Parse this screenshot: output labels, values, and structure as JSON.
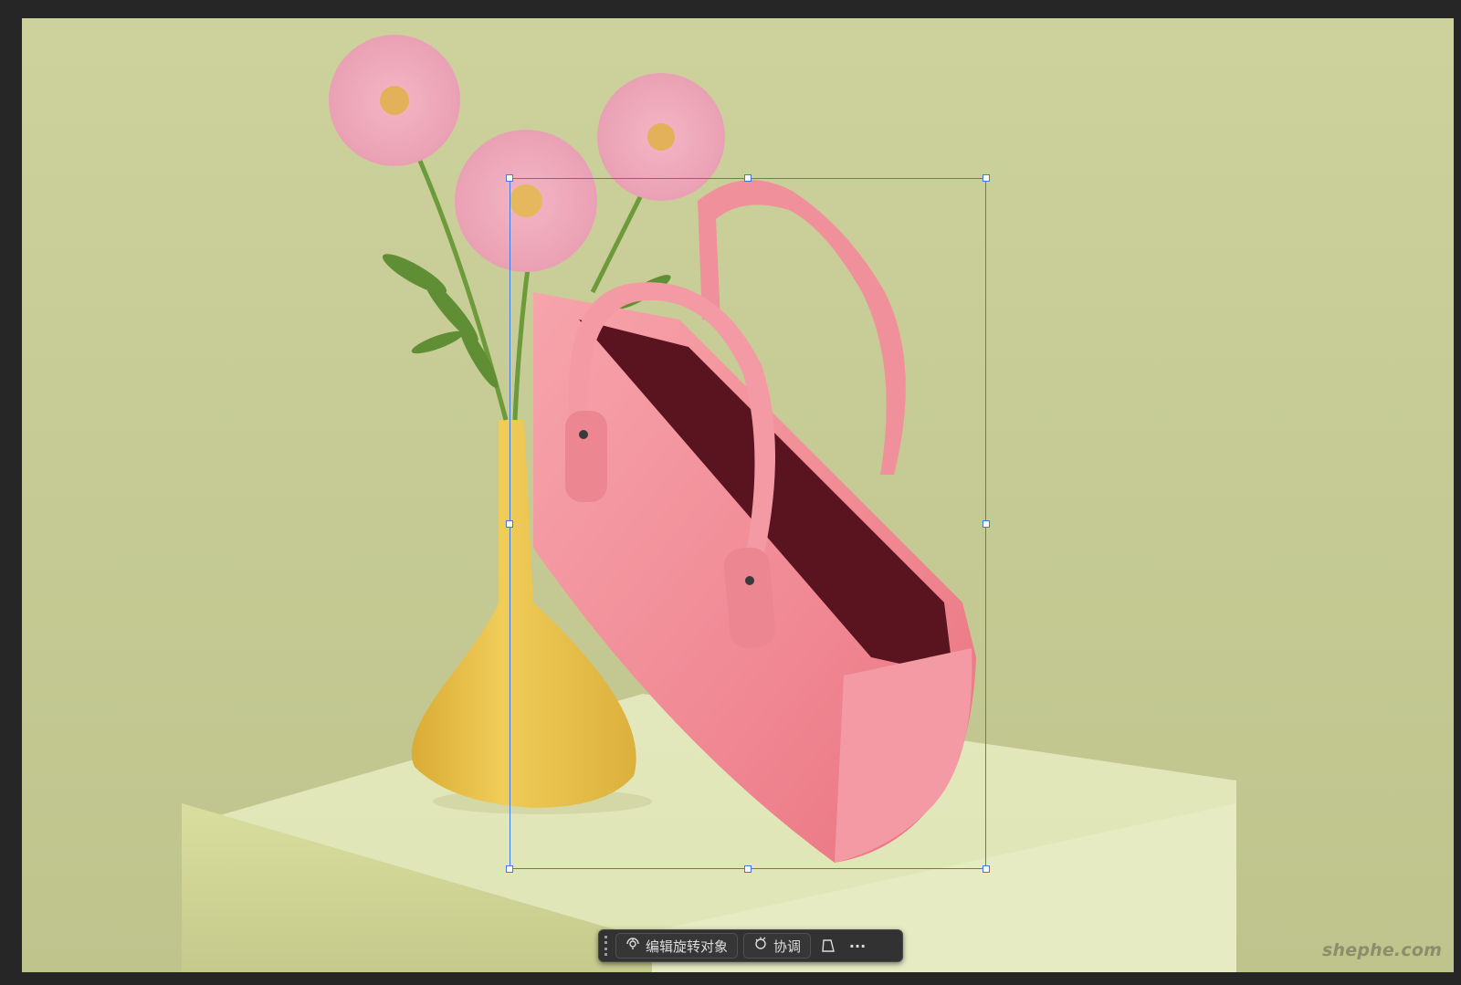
{
  "canvas": {
    "scene": "product photo of pink handbag with pink gerbera daisies in yellow vase on pale green pedestal"
  },
  "contextbar": {
    "edit_rotate_label": "编辑旋转对象",
    "harmonize_label": "协调",
    "more_label": "···"
  },
  "watermark": "shephe.com",
  "colors": {
    "selection": "#3d7be0",
    "bag": "#f28c98",
    "vase": "#e8c24c",
    "background": "#c9cd98"
  }
}
